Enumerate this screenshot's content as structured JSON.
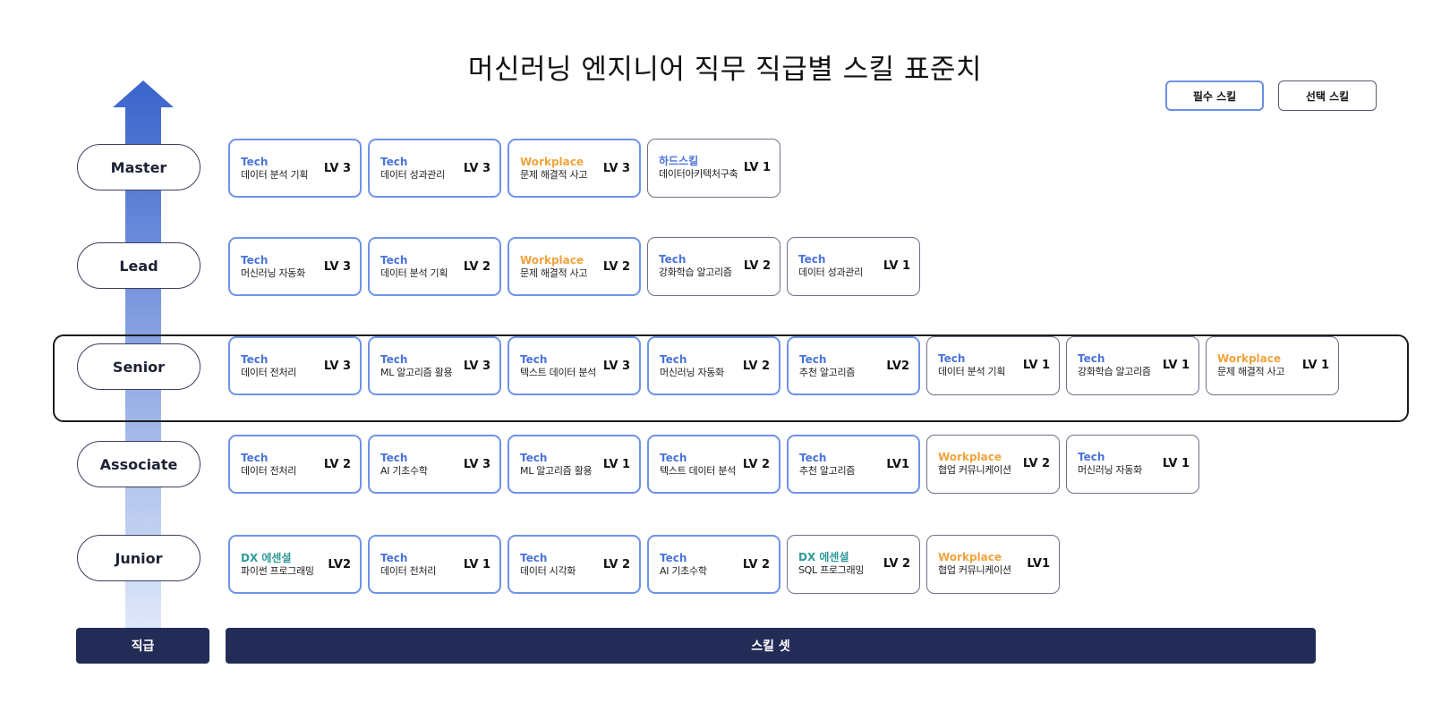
{
  "title": "머신러닝 엔지니어 직무 직급별 스킬 표준치",
  "legend": {
    "required": "필수 스킬",
    "optional": "선택 스킬"
  },
  "colors": {
    "required_border": "#6f93e8",
    "optional_border": "#6d7286",
    "tech": "#4a74db",
    "workplace": "#f0a33c",
    "dx": "#2f9a9a",
    "footer": "#232c57",
    "arrow_top": "#3a64cc",
    "arrow_bottom": "#e1e9fa"
  },
  "levels": [
    {
      "name": "Master",
      "skills": [
        {
          "category": "Tech",
          "cat_type": "tech",
          "name": "데이터 분석 기획",
          "level": "LV 3",
          "required": true
        },
        {
          "category": "Tech",
          "cat_type": "tech",
          "name": "데이터 성과관리",
          "level": "LV 3",
          "required": true
        },
        {
          "category": "Workplace",
          "cat_type": "workplace",
          "name": "문제 해결적 사고",
          "level": "LV 3",
          "required": true
        },
        {
          "category": "하드스킬",
          "cat_type": "hard",
          "name": "데이터아키텍처구축",
          "level": "LV 1",
          "required": false
        }
      ]
    },
    {
      "name": "Lead",
      "skills": [
        {
          "category": "Tech",
          "cat_type": "tech",
          "name": "머신러닝 자동화",
          "level": "LV 3",
          "required": true
        },
        {
          "category": "Tech",
          "cat_type": "tech",
          "name": "데이터 분석 기획",
          "level": "LV 2",
          "required": true
        },
        {
          "category": "Workplace",
          "cat_type": "workplace",
          "name": "문제 해결적 사고",
          "level": "LV 2",
          "required": true
        },
        {
          "category": "Tech",
          "cat_type": "tech",
          "name": "강화학습 알고리즘",
          "level": "LV 2",
          "required": false
        },
        {
          "category": "Tech",
          "cat_type": "tech",
          "name": "데이터 성과관리",
          "level": "LV 1",
          "required": false
        }
      ]
    },
    {
      "name": "Senior",
      "highlighted": true,
      "skills": [
        {
          "category": "Tech",
          "cat_type": "tech",
          "name": "데이터 전처리",
          "level": "LV 3",
          "required": true
        },
        {
          "category": "Tech",
          "cat_type": "tech",
          "name": "ML 알고리즘 활용",
          "level": "LV 3",
          "required": true
        },
        {
          "category": "Tech",
          "cat_type": "tech",
          "name": "텍스트 데이터 분석",
          "level": "LV 3",
          "required": true
        },
        {
          "category": "Tech",
          "cat_type": "tech",
          "name": "머신러닝 자동화",
          "level": "LV 2",
          "required": true
        },
        {
          "category": "Tech",
          "cat_type": "tech",
          "name": "추천 알고리즘",
          "level": "LV2",
          "required": true
        },
        {
          "category": "Tech",
          "cat_type": "tech",
          "name": "데이터 분석 기획",
          "level": "LV 1",
          "required": false
        },
        {
          "category": "Tech",
          "cat_type": "tech",
          "name": "강화학습 알고리즘",
          "level": "LV 1",
          "required": false
        },
        {
          "category": "Workplace",
          "cat_type": "workplace",
          "name": "문제 해결적 사고",
          "level": "LV 1",
          "required": false
        }
      ]
    },
    {
      "name": "Associate",
      "skills": [
        {
          "category": "Tech",
          "cat_type": "tech",
          "name": "데이터 전처리",
          "level": "LV 2",
          "required": true
        },
        {
          "category": "Tech",
          "cat_type": "tech",
          "name": "AI 기초수학",
          "level": "LV 3",
          "required": true
        },
        {
          "category": "Tech",
          "cat_type": "tech",
          "name": "ML 알고리즘 활용",
          "level": "LV 1",
          "required": true
        },
        {
          "category": "Tech",
          "cat_type": "tech",
          "name": "텍스트 데이터 분석",
          "level": "LV 2",
          "required": true
        },
        {
          "category": "Tech",
          "cat_type": "tech",
          "name": "추천 알고리즘",
          "level": "LV1",
          "required": true
        },
        {
          "category": "Workplace",
          "cat_type": "workplace",
          "name": "협업 커뮤니케이션",
          "level": "LV 2",
          "required": false
        },
        {
          "category": "Tech",
          "cat_type": "tech",
          "name": "머신러닝 자동화",
          "level": "LV 1",
          "required": false
        }
      ]
    },
    {
      "name": "Junior",
      "skills": [
        {
          "category": "DX 에센셜",
          "cat_type": "dx",
          "name": "파이썬 프로그래밍",
          "level": "LV2",
          "required": true
        },
        {
          "category": "Tech",
          "cat_type": "tech",
          "name": "데이터 전처리",
          "level": "LV 1",
          "required": true
        },
        {
          "category": "Tech",
          "cat_type": "tech",
          "name": "데이터 시각화",
          "level": "LV 2",
          "required": true
        },
        {
          "category": "Tech",
          "cat_type": "tech",
          "name": "AI 기초수학",
          "level": "LV 2",
          "required": true
        },
        {
          "category": "DX 에센셜",
          "cat_type": "dx",
          "name": "SQL 프로그래밍",
          "level": "LV 2",
          "required": false
        },
        {
          "category": "Workplace",
          "cat_type": "workplace",
          "name": "협업 커뮤니케이션",
          "level": "LV1",
          "required": false
        }
      ]
    }
  ],
  "footer": {
    "level_label": "직급",
    "skills_label": "스킬 셋"
  }
}
